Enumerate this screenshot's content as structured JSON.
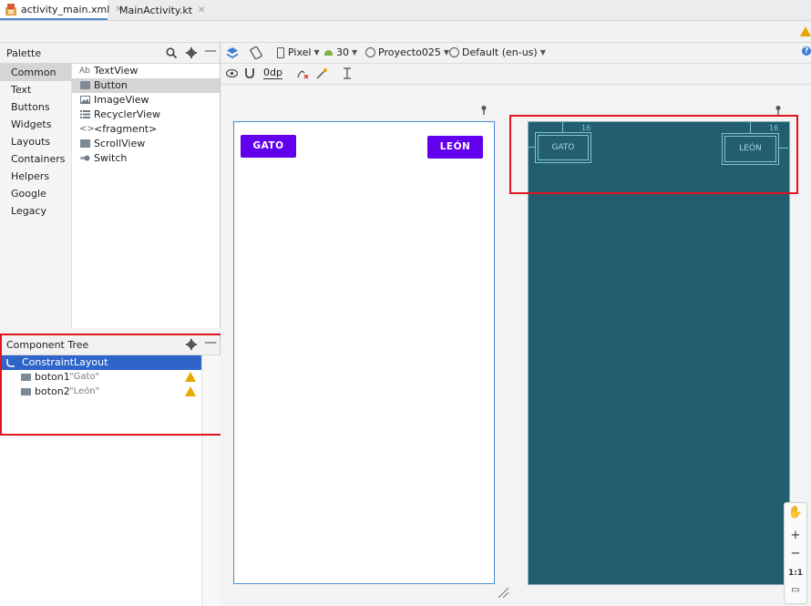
{
  "tabs": [
    {
      "label": "activity_main.xml",
      "active": true
    },
    {
      "label": "MainActivity.kt",
      "active": false
    }
  ],
  "palette": {
    "title": "Palette",
    "categories": [
      "Common",
      "Text",
      "Buttons",
      "Widgets",
      "Layouts",
      "Containers",
      "Helpers",
      "Google",
      "Legacy"
    ],
    "selected_category": "Common",
    "widgets": [
      {
        "label": "TextView",
        "icon": "textview-icon"
      },
      {
        "label": "Button",
        "icon": "button-icon"
      },
      {
        "label": "ImageView",
        "icon": "imageview-icon"
      },
      {
        "label": "RecyclerView",
        "icon": "recyclerview-icon"
      },
      {
        "label": "<fragment>",
        "icon": "fragment-icon"
      },
      {
        "label": "ScrollView",
        "icon": "scrollview-icon"
      },
      {
        "label": "Switch",
        "icon": "switch-icon"
      }
    ],
    "selected_widget": "Button"
  },
  "component_tree": {
    "title": "Component Tree",
    "root": "ConstraintLayout",
    "children": [
      {
        "id": "boton1",
        "text": "\"Gato\""
      },
      {
        "id": "boton2",
        "text": "\"León\""
      }
    ]
  },
  "toolbar": {
    "device": "Pixel",
    "api": "30",
    "theme": "Proyecto025",
    "locale": "Default (en-us)",
    "margin": "0dp"
  },
  "design": {
    "button1": "GATO",
    "button2": "LEÓN"
  },
  "blueprint": {
    "button1": "GATO",
    "button2": "LEÓN",
    "margin_label": "16"
  },
  "zoom": {
    "reset": "1:1"
  },
  "colors": {
    "accent": "#6200ee",
    "blueprint": "#235e6f",
    "selection": "#2f65ca",
    "highlight": "#e0141e"
  }
}
